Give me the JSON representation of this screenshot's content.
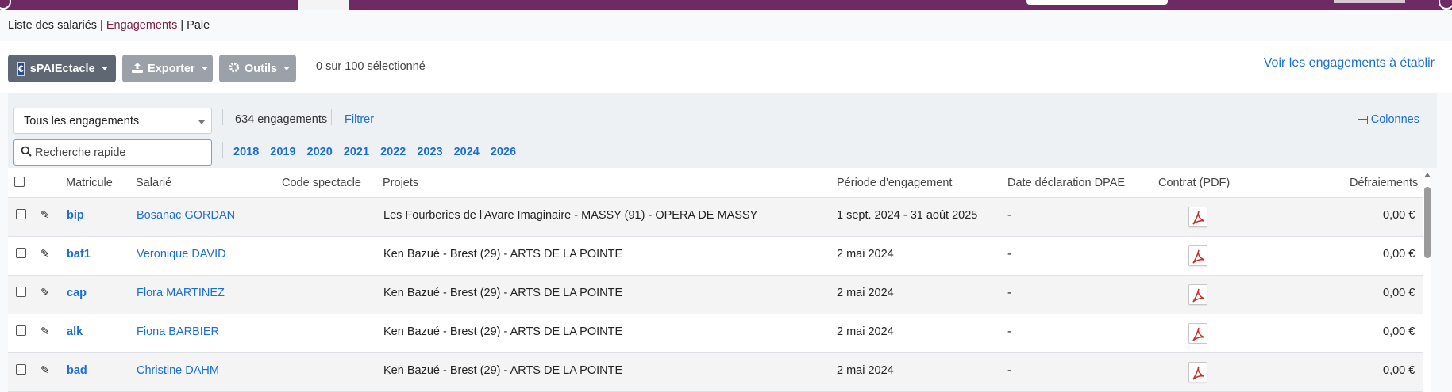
{
  "breadcrumb": {
    "item1": "Liste des salariés",
    "sep1": " | ",
    "item2": "Engagements",
    "sep2": " | ",
    "item3": "Paie"
  },
  "toolbar": {
    "brand_label": "sPAIEctacle",
    "export_label": "Exporter",
    "tools_label": "Outils",
    "selection_text": "0 sur 100 sélectionné",
    "right_link": "Voir les engagements à établir"
  },
  "filters": {
    "select_value": "Tous les engagements",
    "count_text": "634 engagements",
    "filter_link": "Filtrer",
    "columns_link": "Colonnes",
    "search_placeholder": "Recherche rapide",
    "years": [
      "2018",
      "2019",
      "2020",
      "2021",
      "2022",
      "2023",
      "2024",
      "2026"
    ]
  },
  "table": {
    "headers": {
      "matricule": "Matricule",
      "salarie": "Salarié",
      "code_spectacle": "Code spectacle",
      "projets": "Projets",
      "periode": "Période d'engagement",
      "dpae": "Date déclaration DPAE",
      "contrat": "Contrat (PDF)",
      "defraiements": "Défraiements"
    },
    "rows": [
      {
        "matricule": "bip",
        "salarie": "Bosanac GORDAN",
        "code": "",
        "projet": "Les Fourberies de l'Avare Imaginaire - MASSY (91) - OPERA DE MASSY",
        "periode": "1 sept. 2024 - 31 août 2025",
        "dpae": "-",
        "defraiements": "0,00 €"
      },
      {
        "matricule": "baf1",
        "salarie": "Veronique DAVID",
        "code": "",
        "projet": "Ken Bazué - Brest (29) - ARTS DE LA POINTE",
        "periode": "2 mai 2024",
        "dpae": "-",
        "defraiements": "0,00 €"
      },
      {
        "matricule": "cap",
        "salarie": "Flora MARTINEZ",
        "code": "",
        "projet": "Ken Bazué - Brest (29) - ARTS DE LA POINTE",
        "periode": "2 mai 2024",
        "dpae": "-",
        "defraiements": "0,00 €"
      },
      {
        "matricule": "alk",
        "salarie": "Fiona BARBIER",
        "code": "",
        "projet": "Ken Bazué - Brest (29) - ARTS DE LA POINTE",
        "periode": "2 mai 2024",
        "dpae": "-",
        "defraiements": "0,00 €"
      },
      {
        "matricule": "bad",
        "salarie": "Christine DAHM",
        "code": "",
        "projet": "Ken Bazué - Brest (29) - ARTS DE LA POINTE",
        "periode": "2 mai 2024",
        "dpae": "-",
        "defraiements": "0,00 €"
      }
    ]
  },
  "colors": {
    "topbar": "#6e2a63",
    "link": "#1a6fd4",
    "breadcrumb_active": "#7b2340",
    "button_dark": "#5f6772",
    "button_gray": "#9aa1a9"
  },
  "icons": {
    "brand": "brand-logo-icon",
    "export": "upload-icon",
    "tools": "gear-icon",
    "columns": "table-icon",
    "search": "search-icon",
    "edit": "pencil-icon",
    "contract": "pdf-icon"
  }
}
